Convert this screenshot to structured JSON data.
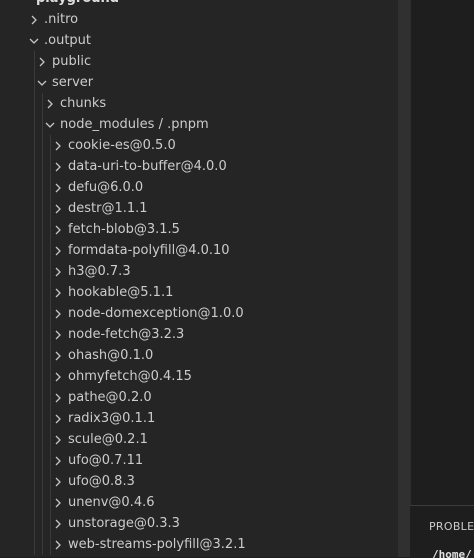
{
  "explorer": {
    "title": "playground",
    "items": [
      {
        "label": ".nitro",
        "level": 1,
        "state": "collapsed"
      },
      {
        "label": ".output",
        "level": 1,
        "state": "expanded"
      },
      {
        "label": "public",
        "level": 2,
        "state": "collapsed"
      },
      {
        "label": "server",
        "level": 2,
        "state": "expanded"
      },
      {
        "label": "chunks",
        "level": 3,
        "state": "collapsed"
      },
      {
        "label": "node_modules / .pnpm",
        "level": 3,
        "state": "expanded"
      },
      {
        "label": "cookie-es@0.5.0",
        "level": 4,
        "state": "collapsed"
      },
      {
        "label": "data-uri-to-buffer@4.0.0",
        "level": 4,
        "state": "collapsed"
      },
      {
        "label": "defu@6.0.0",
        "level": 4,
        "state": "collapsed"
      },
      {
        "label": "destr@1.1.1",
        "level": 4,
        "state": "collapsed"
      },
      {
        "label": "fetch-blob@3.1.5",
        "level": 4,
        "state": "collapsed"
      },
      {
        "label": "formdata-polyfill@4.0.10",
        "level": 4,
        "state": "collapsed"
      },
      {
        "label": "h3@0.7.3",
        "level": 4,
        "state": "collapsed"
      },
      {
        "label": "hookable@5.1.1",
        "level": 4,
        "state": "collapsed"
      },
      {
        "label": "node-domexception@1.0.0",
        "level": 4,
        "state": "collapsed"
      },
      {
        "label": "node-fetch@3.2.3",
        "level": 4,
        "state": "collapsed"
      },
      {
        "label": "ohash@0.1.0",
        "level": 4,
        "state": "collapsed"
      },
      {
        "label": "ohmyfetch@0.4.15",
        "level": 4,
        "state": "collapsed"
      },
      {
        "label": "pathe@0.2.0",
        "level": 4,
        "state": "collapsed"
      },
      {
        "label": "radix3@0.1.1",
        "level": 4,
        "state": "collapsed"
      },
      {
        "label": "scule@0.2.1",
        "level": 4,
        "state": "collapsed"
      },
      {
        "label": "ufo@0.7.11",
        "level": 4,
        "state": "collapsed"
      },
      {
        "label": "ufo@0.8.3",
        "level": 4,
        "state": "collapsed"
      },
      {
        "label": "unenv@0.4.6",
        "level": 4,
        "state": "collapsed"
      },
      {
        "label": "unstorage@0.3.3",
        "level": 4,
        "state": "collapsed"
      },
      {
        "label": "web-streams-polyfill@3.2.1",
        "level": 4,
        "state": "collapsed"
      }
    ]
  },
  "panel": {
    "tab_label": "PROBLEMS",
    "terminal_text": "/home/"
  },
  "colors": {
    "sidebar_bg": "#252526",
    "editor_bg": "#1e1e1e",
    "text": "#cccccc"
  }
}
